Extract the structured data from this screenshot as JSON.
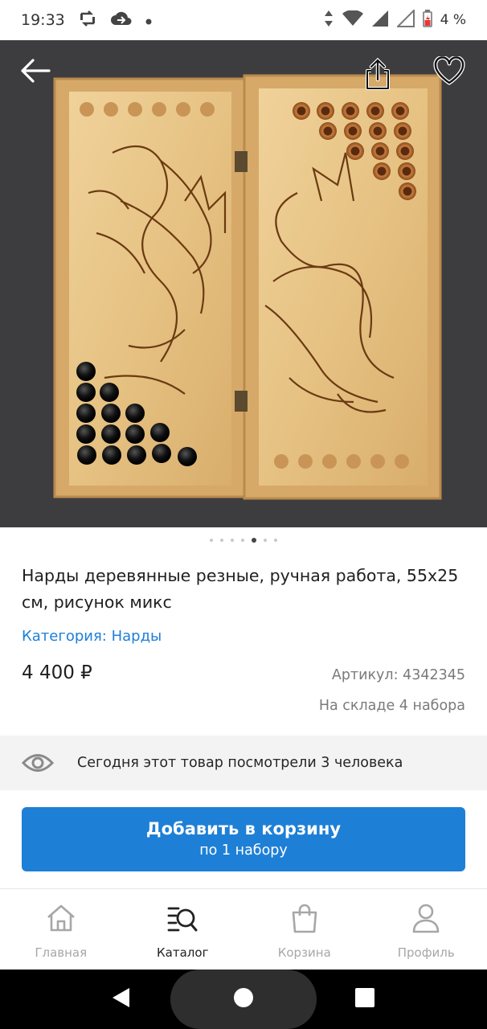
{
  "status_bar": {
    "time": "19:33",
    "battery": "4 %",
    "icons": [
      "sync-icon",
      "cloud-icon",
      "dot-icon",
      "data-arrows-icon",
      "wifi-icon",
      "signal-icon",
      "signal-empty-icon",
      "battery-icon"
    ]
  },
  "hero": {
    "image_icon": "backgammon-board-with-dragons",
    "back_icon": "arrow-left-icon",
    "share_icon": "share-icon",
    "favorite_icon": "heart-outline-icon"
  },
  "carousel": {
    "count": 7,
    "active_index": 4
  },
  "product": {
    "title": "Нарды деревянные резные, ручная работа, 55х25 см, рисунок микс",
    "category": "Категория: Нарды",
    "price": "4 400 ₽",
    "sku": "Артикул: 4342345",
    "stock": "На складе 4 набора"
  },
  "viewers": {
    "text": "Сегодня этот товар посмотрели 3 человека",
    "icon": "eye-icon"
  },
  "cart_button": {
    "line1": "Добавить в корзину",
    "line2": "по 1 набору"
  },
  "tabs": [
    {
      "label": "Главная",
      "icon": "home-icon",
      "active": false
    },
    {
      "label": "Каталог",
      "icon": "catalog-search-icon",
      "active": true
    },
    {
      "label": "Корзина",
      "icon": "bag-icon",
      "active": false
    },
    {
      "label": "Профиль",
      "icon": "profile-icon",
      "active": false
    }
  ],
  "colors": {
    "accent": "#1e7fd6",
    "inactive_tab": "#a7a7a7",
    "wood": "#e8c78d"
  }
}
